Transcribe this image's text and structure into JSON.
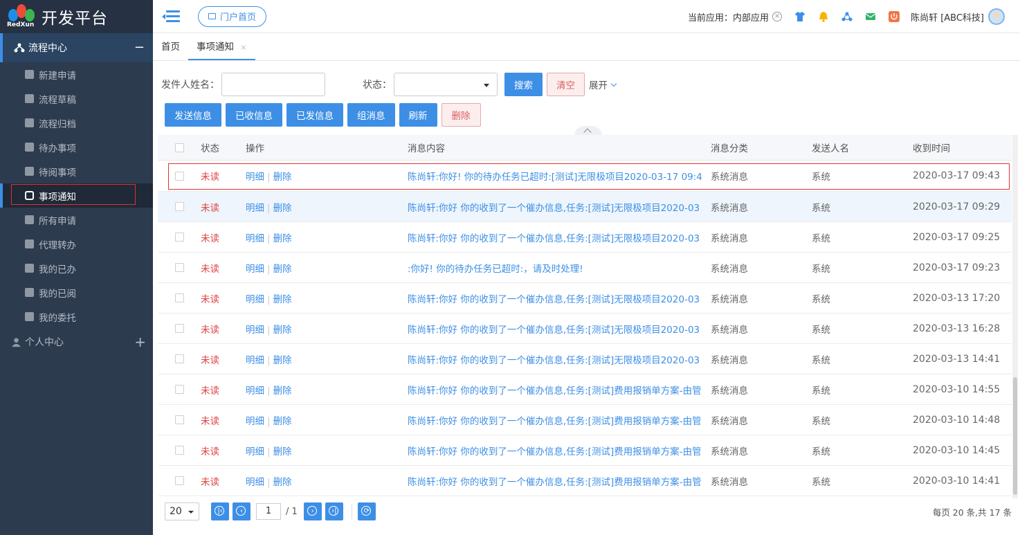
{
  "brand": {
    "logo_text": "RedXun",
    "title": "开发平台"
  },
  "sidebar": {
    "section1": "流程中心",
    "section1_toggle": "−",
    "items": [
      {
        "label": "新建申请",
        "icon": "file-icon"
      },
      {
        "label": "流程草稿",
        "icon": "edit-icon"
      },
      {
        "label": "流程归档",
        "icon": "archive-icon"
      },
      {
        "label": "待办事项",
        "icon": "todo-icon"
      },
      {
        "label": "待阅事项",
        "icon": "send-icon"
      },
      {
        "label": "事项通知",
        "icon": "chat-icon"
      },
      {
        "label": "所有申请",
        "icon": "grid-icon"
      },
      {
        "label": "代理转办",
        "icon": "agent-icon"
      },
      {
        "label": "我的已办",
        "icon": "clipboard-icon"
      },
      {
        "label": "我的已阅",
        "icon": "book-icon"
      },
      {
        "label": "我的委托",
        "icon": "calendar-icon"
      }
    ],
    "section2": "个人中心",
    "section2_toggle": "+"
  },
  "topbar": {
    "portal_label": "门户首页",
    "current_app": "当前应用：内部应用",
    "user_name": "陈尚轩 [ABC科技]",
    "colors": {
      "shirt": "#3d8fe6",
      "bell": "#f5b400",
      "flow": "#3d8fe6",
      "mail": "#35b36b",
      "power": "#f07848"
    }
  },
  "tabs": [
    {
      "label": "首页"
    },
    {
      "label": "事项通知",
      "close": "×"
    }
  ],
  "filter": {
    "sender_label": "发件人姓名：",
    "status_label": "状态：",
    "search_label": "搜索",
    "clear_label": "清空",
    "expand_label": "展开"
  },
  "actions": {
    "send": "发送信息",
    "received": "已收信息",
    "sent": "已发信息",
    "group": "组消息",
    "refresh": "刷新",
    "delete": "删除"
  },
  "table": {
    "headers": {
      "status": "状态",
      "op": "操作",
      "content": "消息内容",
      "category": "消息分类",
      "sender": "发送人名",
      "time": "收到时间"
    },
    "op_detail": "明细",
    "op_sep": "|",
    "op_delete": "删除",
    "rows": [
      {
        "status": "未读",
        "content": "陈尚轩:你好!  你的待办任务已超时:[测试]无限极项目2020-03-17 09:4",
        "category": "系统消息",
        "sender": "系统",
        "time": "2020-03-17 09:43"
      },
      {
        "status": "未读",
        "content": "陈尚轩:你好 你的收到了一个催办信息,任务:[测试]无限极项目2020-03",
        "category": "系统消息",
        "sender": "系统",
        "time": "2020-03-17 09:29"
      },
      {
        "status": "未读",
        "content": "陈尚轩:你好 你的收到了一个催办信息,任务:[测试]无限极项目2020-03",
        "category": "系统消息",
        "sender": "系统",
        "time": "2020-03-17 09:25"
      },
      {
        "status": "未读",
        "content": ":你好!  你的待办任务已超时:，请及时处理!",
        "category": "系统消息",
        "sender": "系统",
        "time": "2020-03-17 09:23"
      },
      {
        "status": "未读",
        "content": "陈尚轩:你好 你的收到了一个催办信息,任务:[测试]无限极项目2020-03",
        "category": "系统消息",
        "sender": "系统",
        "time": "2020-03-13 17:20"
      },
      {
        "status": "未读",
        "content": "陈尚轩:你好 你的收到了一个催办信息,任务:[测试]无限极项目2020-03",
        "category": "系统消息",
        "sender": "系统",
        "time": "2020-03-13 16:28"
      },
      {
        "status": "未读",
        "content": "陈尚轩:你好 你的收到了一个催办信息,任务:[测试]无限极项目2020-03",
        "category": "系统消息",
        "sender": "系统",
        "time": "2020-03-13 14:41"
      },
      {
        "status": "未读",
        "content": "陈尚轩:你好 你的收到了一个催办信息,任务:[测试]费用报销单方案-由管",
        "category": "系统消息",
        "sender": "系统",
        "time": "2020-03-10 14:55"
      },
      {
        "status": "未读",
        "content": "陈尚轩:你好 你的收到了一个催办信息,任务:[测试]费用报销单方案-由管",
        "category": "系统消息",
        "sender": "系统",
        "time": "2020-03-10 14:48"
      },
      {
        "status": "未读",
        "content": "陈尚轩:你好 你的收到了一个催办信息,任务:[测试]费用报销单方案-由管",
        "category": "系统消息",
        "sender": "系统",
        "time": "2020-03-10 14:45"
      },
      {
        "status": "未读",
        "content": "陈尚轩:你好 你的收到了一个催办信息,任务:[测试]费用报销单方案-由管",
        "category": "系统消息",
        "sender": "系统",
        "time": "2020-03-10 14:41"
      }
    ]
  },
  "pager": {
    "page_size": "20",
    "page": "1",
    "total_pages": "/ 1",
    "info": "每页 20 条,共 17 条"
  }
}
